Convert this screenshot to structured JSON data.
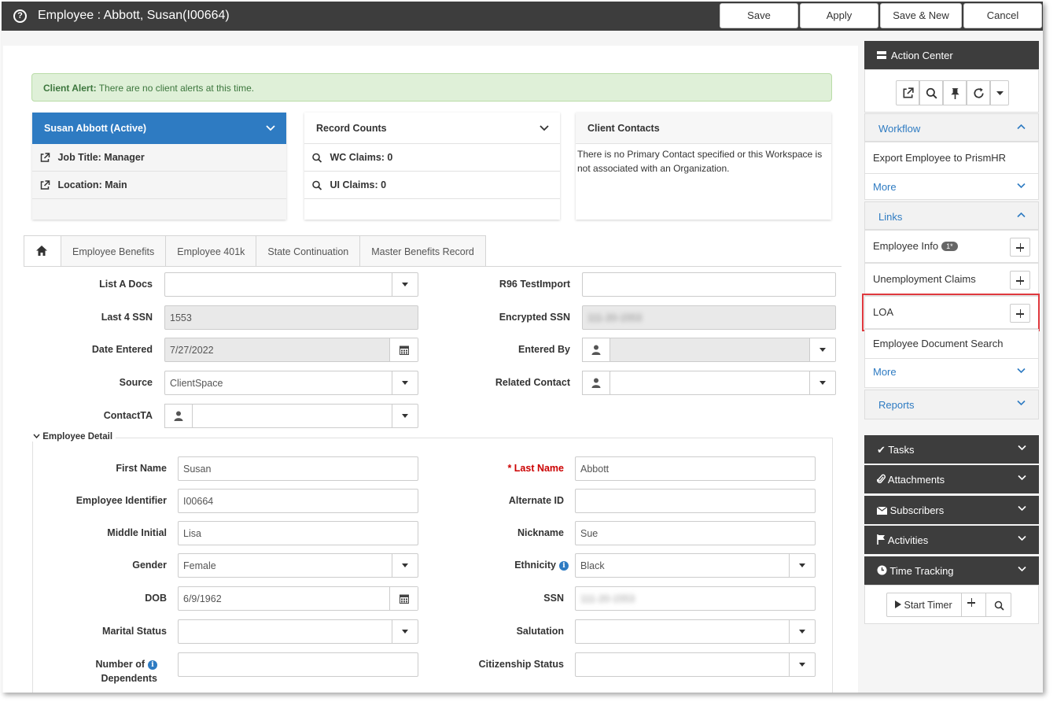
{
  "window": {
    "title": "Employee : Abbott, Susan(I00664)"
  },
  "toolbar": {
    "save": "Save",
    "apply": "Apply",
    "save_new": "Save & New",
    "cancel": "Cancel"
  },
  "alert": {
    "label": "Client Alert:",
    "text": "There are no client alerts at this time."
  },
  "employee_card": {
    "title": "Susan Abbott (Active)",
    "job_title": "Job Title: Manager",
    "location": "Location: Main"
  },
  "record_counts": {
    "title": "Record Counts",
    "wc": "WC Claims: 0",
    "ui": "UI Claims: 0"
  },
  "client_contacts": {
    "title": "Client Contacts",
    "text": "There is no Primary Contact specified or this Workspace is not associated with an Organization."
  },
  "tabs": [
    "Employee Benefits",
    "Employee 401k",
    "State Continuation",
    "Master Benefits Record"
  ],
  "form": {
    "list_a_docs": {
      "label": "List A Docs",
      "value": ""
    },
    "r96": {
      "label": "R96 TestImport",
      "value": ""
    },
    "last4": {
      "label": "Last 4 SSN",
      "value": "1553"
    },
    "encrypted_ssn": {
      "label": "Encrypted SSN",
      "value": "111-20-1553"
    },
    "date_entered": {
      "label": "Date Entered",
      "value": "7/27/2022"
    },
    "entered_by": {
      "label": "Entered By",
      "value": ""
    },
    "source": {
      "label": "Source",
      "value": "ClientSpace"
    },
    "related_contact": {
      "label": "Related Contact",
      "value": ""
    },
    "contact_ta": {
      "label": "ContactTA",
      "value": ""
    }
  },
  "detail": {
    "legend": "Employee Detail",
    "first_name": {
      "label": "First Name",
      "value": "Susan"
    },
    "last_name": {
      "label": "* Last Name",
      "value": "Abbott"
    },
    "employee_identifier": {
      "label": "Employee Identifier",
      "value": "I00664"
    },
    "alternate_id": {
      "label": "Alternate ID",
      "value": ""
    },
    "middle_initial": {
      "label": "Middle Initial",
      "value": "Lisa"
    },
    "nickname": {
      "label": "Nickname",
      "value": "Sue"
    },
    "gender": {
      "label": "Gender",
      "value": "Female"
    },
    "ethnicity": {
      "label": "Ethnicity",
      "value": "Black"
    },
    "dob": {
      "label": "DOB",
      "value": "6/9/1962"
    },
    "ssn": {
      "label": "SSN",
      "value": "111-20-1553"
    },
    "marital_status": {
      "label": "Marital Status",
      "value": ""
    },
    "salutation": {
      "label": "Salutation",
      "value": ""
    },
    "dependents": {
      "label1": "Number of",
      "label2": "Dependents",
      "value": ""
    },
    "citizenship": {
      "label": "Citizenship Status",
      "value": ""
    }
  },
  "sidebar": {
    "action_center": "Action Center",
    "workflow": {
      "title": "Workflow",
      "items": [
        "Export Employee to PrismHR"
      ],
      "more": "More"
    },
    "links": {
      "title": "Links",
      "employee_info": "Employee Info",
      "badge": "1*",
      "unemployment": "Unemployment Claims",
      "loa": "LOA",
      "doc_search": "Employee Document Search",
      "more": "More"
    },
    "reports": "Reports",
    "tasks": "Tasks",
    "attachments": "Attachments",
    "subscribers": "Subscribers",
    "activities": "Activities",
    "time_tracking": "Time Tracking",
    "start_timer": "Start Timer"
  }
}
